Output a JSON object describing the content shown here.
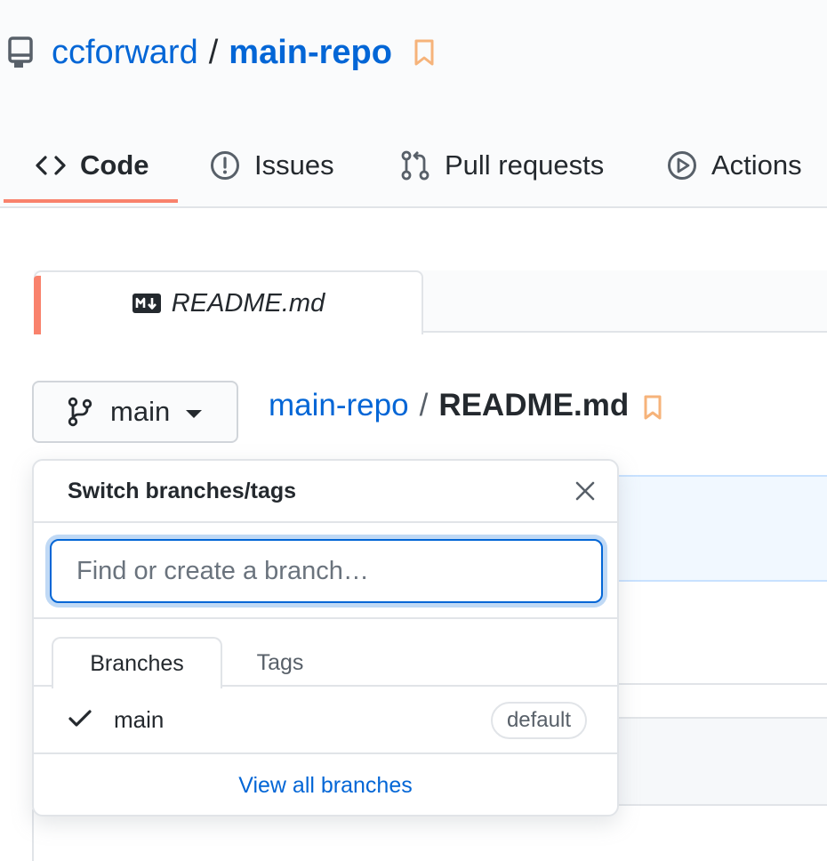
{
  "repo": {
    "owner": "ccforward",
    "separator": "/",
    "name": "main-repo"
  },
  "tabs": [
    {
      "label": "Code",
      "icon": "code-icon",
      "active": true
    },
    {
      "label": "Issues",
      "icon": "issue-opened-icon"
    },
    {
      "label": "Pull requests",
      "icon": "git-pull-request-icon"
    },
    {
      "label": "Actions",
      "icon": "play-icon"
    }
  ],
  "file_tab": {
    "label": "README.md",
    "icon": "markdown-icon"
  },
  "branch_button": {
    "label": "main",
    "icon": "git-branch-icon"
  },
  "breadcrumb": {
    "repo": "main-repo",
    "separator": "/",
    "file": "README.md"
  },
  "dropdown": {
    "title": "Switch branches/tags",
    "filter_placeholder": "Find or create a branch…",
    "tabs": [
      "Branches",
      "Tags"
    ],
    "branches": [
      {
        "name": "main",
        "badge": "default",
        "selected": true
      }
    ],
    "footer_link": "View all branches"
  },
  "colors": {
    "link": "#0366d6",
    "active_tab_underline": "#f9826c",
    "bookmark": "#f9c513"
  }
}
